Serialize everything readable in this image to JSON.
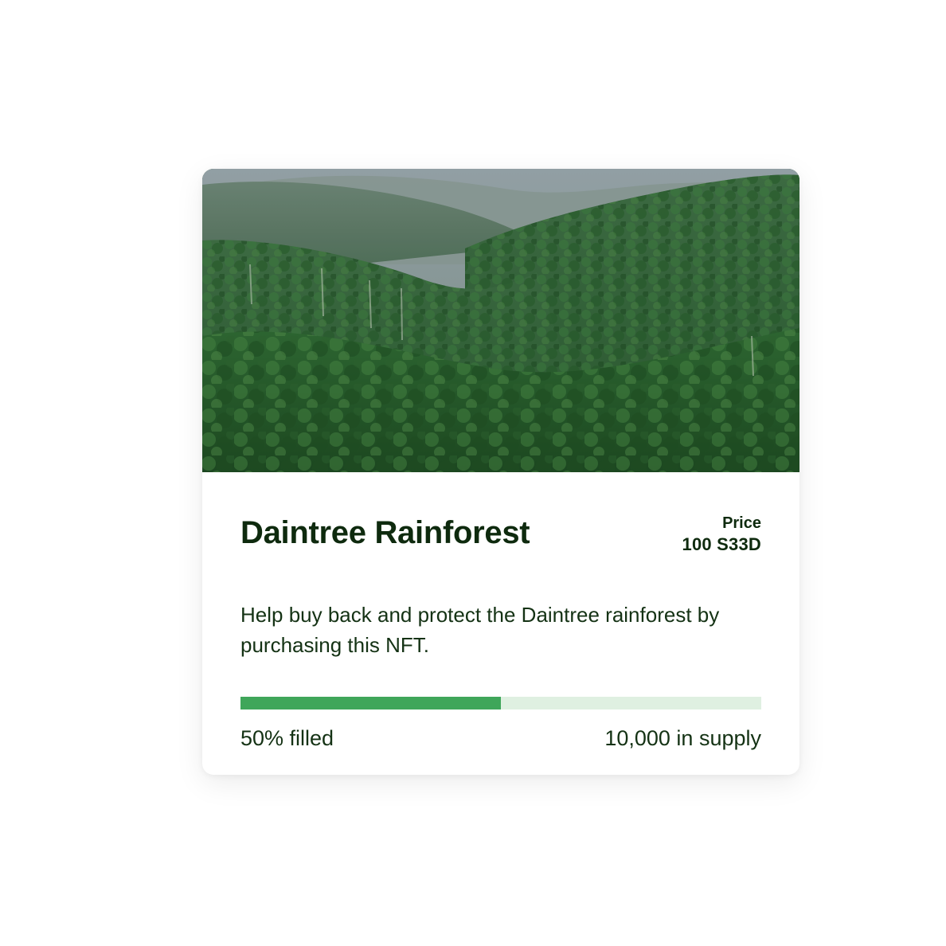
{
  "card": {
    "image_alt": "Aerial view of green rainforest-covered mountain valley",
    "title": "Daintree Rainforest",
    "price_label": "Price",
    "price_value": "100 S33D",
    "description": "Help buy back and protect the Daintree rainforest by purchasing this NFT.",
    "progress_percent": 50,
    "filled_text": "50% filled",
    "supply_text": "10,000 in supply"
  },
  "colors": {
    "title": "#0e2a0e",
    "progress_fill": "#3fa65a",
    "progress_track": "#dff0e1"
  }
}
